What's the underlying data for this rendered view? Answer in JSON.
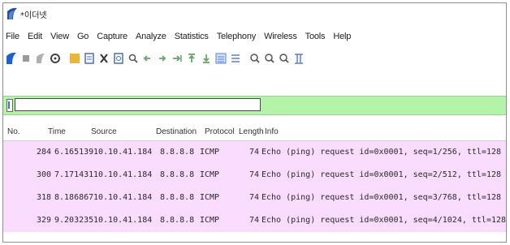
{
  "window": {
    "title": "*이더넷",
    "brand_color": "#1f4fa8"
  },
  "menu": {
    "items": [
      "File",
      "Edit",
      "View",
      "Go",
      "Capture",
      "Analyze",
      "Statistics",
      "Telephony",
      "Wireless",
      "Tools",
      "Help"
    ]
  },
  "toolbar": {
    "buttons": [
      {
        "name": "start-capture-icon",
        "color": "#1f5fd0"
      },
      {
        "name": "stop-capture-icon",
        "color": "#9a9a9a"
      },
      {
        "name": "restart-capture-icon",
        "color": "#9a9a9a"
      },
      {
        "name": "capture-options-icon",
        "color": "#444444"
      },
      {
        "name": "open-file-icon",
        "color": "#e9b43a"
      },
      {
        "name": "save-file-icon",
        "color": "#4a6fb8"
      },
      {
        "name": "close-file-icon",
        "color": "#444444"
      },
      {
        "name": "reload-file-icon",
        "color": "#4a6fb8"
      },
      {
        "name": "find-packet-icon",
        "color": "#555555"
      },
      {
        "name": "go-back-icon",
        "color": "#6aa36a"
      },
      {
        "name": "go-forward-icon",
        "color": "#6aa36a"
      },
      {
        "name": "go-to-packet-icon",
        "color": "#6aa36a"
      },
      {
        "name": "go-first-icon",
        "color": "#6aa36a"
      },
      {
        "name": "go-last-icon",
        "color": "#6aa36a"
      },
      {
        "name": "autoscroll-icon",
        "color": "#5a7fd0"
      },
      {
        "name": "colorize-icon",
        "color": "#5a7fd0"
      },
      {
        "name": "zoom-in-icon",
        "color": "#555555"
      },
      {
        "name": "zoom-out-icon",
        "color": "#555555"
      },
      {
        "name": "normal-size-icon",
        "color": "#555555"
      },
      {
        "name": "resize-columns-icon",
        "color": "#5a7fd0"
      }
    ]
  },
  "filter": {
    "value": "",
    "bar_color": "#b4f4a8"
  },
  "packet_list": {
    "columns": [
      "No.",
      "Time",
      "Source",
      "Destination",
      "Protocol",
      "Length",
      "Info"
    ],
    "row_color": "#fadcff",
    "rows": [
      {
        "no": "284",
        "time": "6.165139",
        "source": "10.10.41.184",
        "destination": "8.8.8.8",
        "protocol": "ICMP",
        "length": "74",
        "info": "Echo (ping) request  id=0x0001, seq=1/256, ttl=128"
      },
      {
        "no": "300",
        "time": "7.171431",
        "source": "10.10.41.184",
        "destination": "8.8.8.8",
        "protocol": "ICMP",
        "length": "74",
        "info": "Echo (ping) request  id=0x0001, seq=2/512, ttl=128"
      },
      {
        "no": "318",
        "time": "8.186867",
        "source": "10.10.41.184",
        "destination": "8.8.8.8",
        "protocol": "ICMP",
        "length": "74",
        "info": "Echo (ping) request  id=0x0001, seq=3/768, ttl=128"
      },
      {
        "no": "329",
        "time": "9.203235",
        "source": "10.10.41.184",
        "destination": "8.8.8.8",
        "protocol": "ICMP",
        "length": "74",
        "info": "Echo (ping) request  id=0x0001, seq=4/1024, ttl=128"
      }
    ]
  }
}
